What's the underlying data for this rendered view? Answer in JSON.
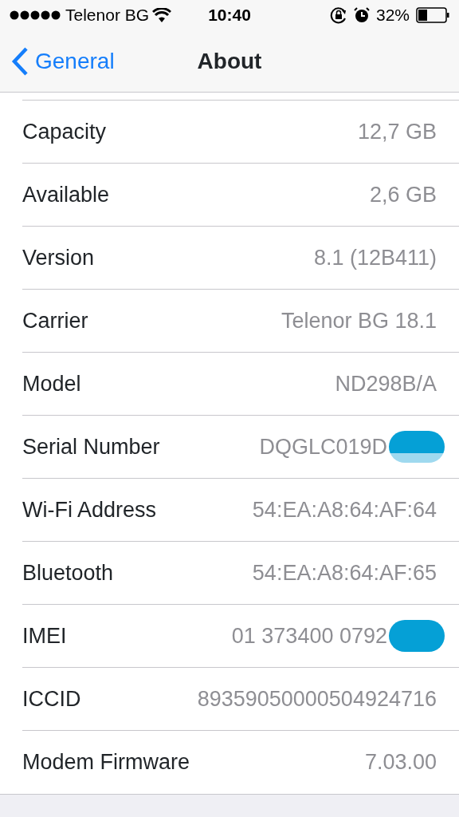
{
  "status_bar": {
    "carrier": "Telenor BG",
    "time": "10:40",
    "battery": "32%"
  },
  "nav": {
    "back": "General",
    "title": "About"
  },
  "rows": [
    {
      "label": "Capacity",
      "value": "12,7 GB",
      "redacted": false
    },
    {
      "label": "Available",
      "value": "2,6 GB",
      "redacted": false
    },
    {
      "label": "Version",
      "value": "8.1 (12B411)",
      "redacted": false
    },
    {
      "label": "Carrier",
      "value": "Telenor BG 18.1",
      "redacted": false
    },
    {
      "label": "Model",
      "value": "ND298B/A",
      "redacted": false
    },
    {
      "label": "Serial Number",
      "value": "DQGLC019D",
      "redacted": true
    },
    {
      "label": "Wi-Fi Address",
      "value": "54:EA:A8:64:AF:64",
      "redacted": false
    },
    {
      "label": "Bluetooth",
      "value": "54:EA:A8:64:AF:65",
      "redacted": false
    },
    {
      "label": "IMEI",
      "value": "01 373400 0792",
      "redacted": true
    },
    {
      "label": "ICCID",
      "value": "89359050000504924716",
      "redacted": false
    },
    {
      "label": "Modem Firmware",
      "value": "7.03.00",
      "redacted": false
    }
  ]
}
